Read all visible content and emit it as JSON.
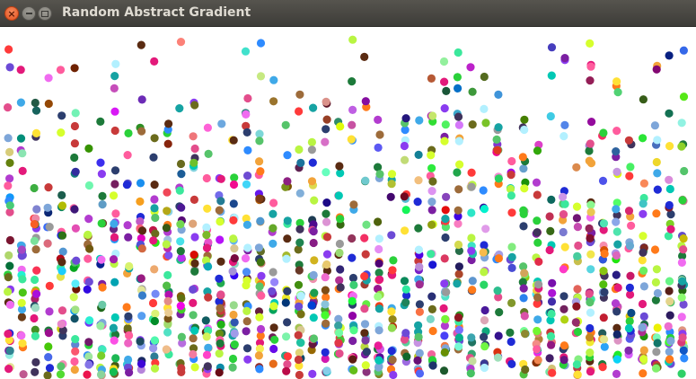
{
  "window": {
    "title": "Random Abstract Gradient",
    "buttons": {
      "close_glyph": "×",
      "minimize_icon": "minimize-icon",
      "maximize_icon": "maximize-icon"
    }
  },
  "colors": {
    "background": "#ffffff",
    "titlebar": "#3d3c38",
    "close_button": "#e3521f",
    "dot_palette": [
      "#e3197a",
      "#1f2bd6",
      "#2ad13a",
      "#8a3cf0",
      "#f2a33a",
      "#16a3a3",
      "#6b6b1c",
      "#2c3e6e",
      "#ff5c9d",
      "#3be89c",
      "#b9f542",
      "#b23ccf",
      "#5a2b12",
      "#3fa9e8",
      "#9a9a9a",
      "#d6ff2d",
      "#c83a3a",
      "#1d7a3a",
      "#7ea6d9",
      "#f06bf0",
      "#6c4ad6",
      "#00c8b4",
      "#ffe135",
      "#40335c",
      "#ff7a1a",
      "#2e8bff",
      "#e34e8c",
      "#56c46a",
      "#9d6b3a",
      "#b2f0ff",
      "#ff3a3a",
      "#7b1fa2"
    ]
  },
  "dots": {
    "count": 1400,
    "distribution": "density increases toward bottom"
  }
}
